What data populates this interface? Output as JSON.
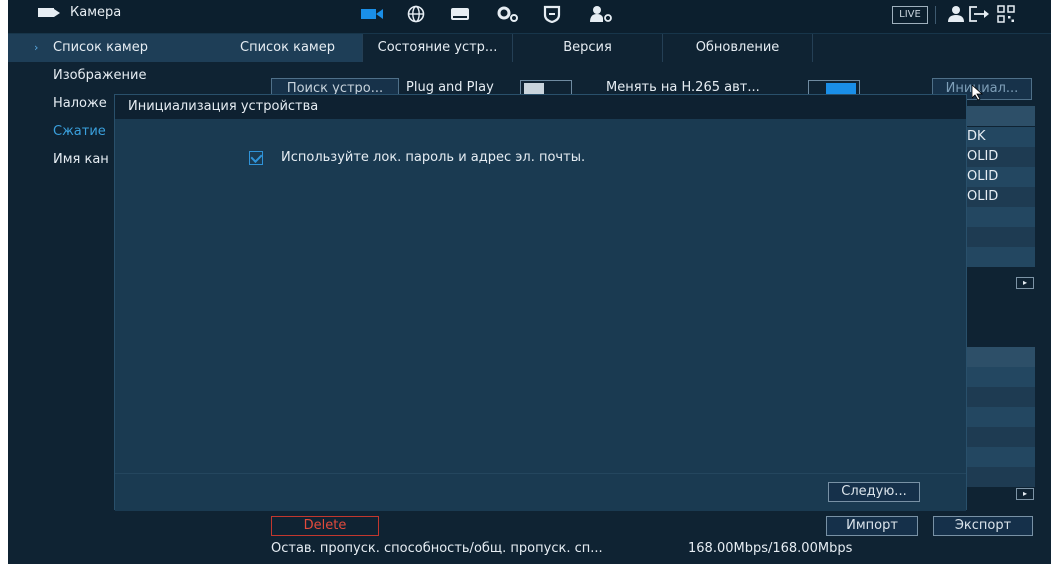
{
  "header": {
    "app_title": "Камера",
    "live_label": "LIVE"
  },
  "sidebar": {
    "items": [
      {
        "label": "Список камер"
      },
      {
        "label": "Изображение"
      },
      {
        "label": "Наложе"
      },
      {
        "label": "Сжатие"
      },
      {
        "label": "Имя кан"
      }
    ]
  },
  "tabs": [
    {
      "label": "Список камер"
    },
    {
      "label": "Состояние устр..."
    },
    {
      "label": "Версия"
    },
    {
      "label": "Обновление"
    }
  ],
  "toolbar": {
    "search_button": "Поиск устро...",
    "plug_and_play_label": "Plug and Play",
    "h265_label": "Менять на H.265 авт...",
    "init_button": "Инициал..."
  },
  "right_column": {
    "cells": [
      "DK",
      "OLID",
      "OLID",
      "OLID"
    ]
  },
  "modal": {
    "title": "Инициализация устройства",
    "checkbox_label": "Используйте лок. пароль и адрес эл. почты.",
    "checkbox_checked": true,
    "next_button": "Следую..."
  },
  "bottom": {
    "delete_button": "Delete",
    "import_button": "Импорт",
    "export_button": "Экспорт",
    "bandwidth_label": "Остав. пропуск. способность/общ. пропуск. сп...",
    "bandwidth_value": "168.00Mbps/168.00Mbps"
  },
  "colors": {
    "accent": "#1a8fe8",
    "background": "#0f2333",
    "danger": "#e24a3c"
  },
  "icons": [
    "camera-icon",
    "network-icon",
    "storage-icon",
    "settings-icon",
    "shield-icon",
    "account-settings-icon",
    "user-icon",
    "logout-icon",
    "qr-icon"
  ]
}
